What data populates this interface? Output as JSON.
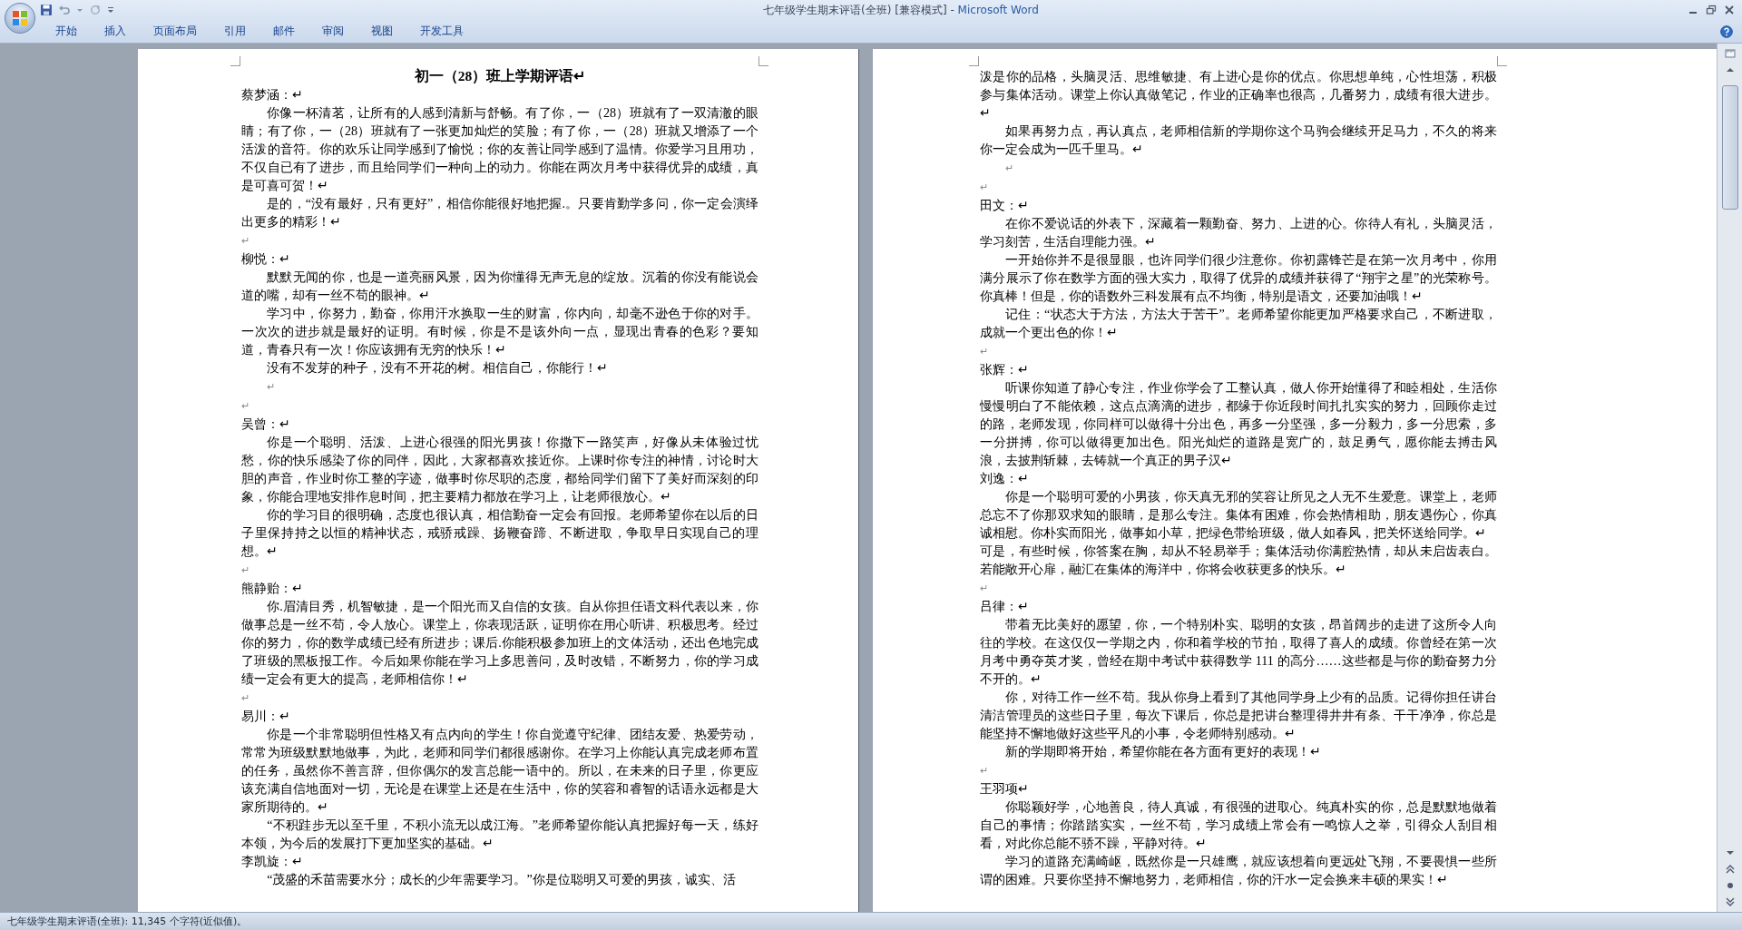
{
  "window": {
    "title": "七年级学生期末评语(全班) [兼容模式] -",
    "app_name": "Microsoft Word"
  },
  "tabs": [
    {
      "label": "开始",
      "selected": false
    },
    {
      "label": "插入",
      "selected": false
    },
    {
      "label": "页面布局",
      "selected": false
    },
    {
      "label": "引用",
      "selected": false
    },
    {
      "label": "邮件",
      "selected": false
    },
    {
      "label": "审阅",
      "selected": false
    },
    {
      "label": "视图",
      "selected": false
    },
    {
      "label": "开发工具",
      "selected": false
    }
  ],
  "pages": [
    {
      "blocks": [
        {
          "kind": "title",
          "text": "初一（28）班上学期评语↵"
        },
        {
          "kind": "name",
          "text": "蔡梦涵：↵"
        },
        {
          "kind": "para",
          "text": "你像一杯清茗，让所有的人感到清新与舒畅。有了你，一（28）班就有了一双清澈的眼睛；有了你，一（28）班就有了一张更加灿烂的笑脸；有了你，一（28）班就又增添了一个活泼的音符。你的欢乐让同学感到了愉悦；你的友善让同学感到了温情。你爱学习且用功，不仅自已有了进步，而且给同学们一种向上的动力。你能在两次月考中获得优异的成绩，真是可喜可贺！↵"
        },
        {
          "kind": "para",
          "text": "是的，“没有最好，只有更好”，相信你能很好地把握.。只要肯勤学多问，你一定会演绎出更多的精彩！↵"
        },
        {
          "kind": "blank",
          "text": "↵"
        },
        {
          "kind": "name",
          "text": "柳悦：↵"
        },
        {
          "kind": "para",
          "text": "默默无闻的你，也是一道亮丽风景，因为你懂得无声无息的绽放。沉着的你没有能说会道的嘴，却有一丝不苟的眼神。↵"
        },
        {
          "kind": "para",
          "text": "学习中，你努力，勤奋，你用汗水换取一生的财富，你内向，却毫不逊色于你的对手。一次次的进步就是最好的证明。有时候，你是不是该外向一点，显现出青春的色彩？要知道，青春只有一次！你应该拥有无穷的快乐！↵"
        },
        {
          "kind": "para",
          "text": "没有不发芽的种子，没有不开花的树。相信自己，你能行！↵"
        },
        {
          "kind": "blank-indented",
          "text": "↵"
        },
        {
          "kind": "blank",
          "text": "↵"
        },
        {
          "kind": "name",
          "text": "吴曾：↵"
        },
        {
          "kind": "para",
          "text": "你是一个聪明、活泼、上进心很强的阳光男孩！你撒下一路笑声，好像从未体验过忧愁，你的快乐感染了你的同伴，因此，大家都喜欢接近你。上课时你专注的神情，讨论时大胆的声音，作业时你工整的字迹，做事时你尽职的态度，都给同学们留下了美好而深刻的印象，你能合理地安排作息时间，把主要精力都放在学习上，让老师很放心。↵"
        },
        {
          "kind": "para",
          "text": "你的学习目的很明确，态度也很认真，相信勤奋一定会有回报。老师希望你在以后的日子里保持持之以恒的精神状态，戒骄戒躁、扬鞭奋蹄、不断进取，争取早日实现自己的理想。↵"
        },
        {
          "kind": "blank",
          "text": "↵"
        },
        {
          "kind": "name",
          "text": "熊静贻：↵"
        },
        {
          "kind": "para",
          "text": "你.眉清目秀，机智敏捷，是一个阳光而又自信的女孩。自从你担任语文科代表以来，你做事总是一丝不苟，令人放心。课堂上，你表现活跃，证明你在用心听讲、积极思考。经过你的努力，你的数学成绩已经有所进步；课后.你能积极参加班上的文体活动，还出色地完成了班级的黑板报工作。今后如果你能在学习上多思善问，及时改错，不断努力，你的学习成绩一定会有更大的提高，老师相信你！↵"
        },
        {
          "kind": "blank",
          "text": "↵"
        },
        {
          "kind": "name",
          "text": "易川：↵"
        },
        {
          "kind": "para",
          "text": "你是一个非常聪明但性格又有点内向的学生！你自觉遵守纪律、团结友爱、热爱劳动，常常为班级默默地做事，为此，老师和同学们都很感谢你。在学习上你能认真完成老师布置的任务，虽然你不善言辞，但你偶尔的发言总能一语中的。所以，在未来的日子里，你更应该充满自信地面对一切，无论是在课堂上还是在生活中，你的笑容和睿智的话语永远都是大家所期待的。↵"
        },
        {
          "kind": "para",
          "text": "“不积跬步无以至千里，不积小流无以成江海。”老师希望你能认真把握好每一天，练好本领，为今后的发展打下更加坚实的基础。↵"
        },
        {
          "kind": "name",
          "text": "李凯旋：↵"
        },
        {
          "kind": "para",
          "text": "“茂盛的禾苗需要水分；成长的少年需要学习。”你是位聪明又可爱的男孩，诚实、活"
        }
      ]
    },
    {
      "blocks": [
        {
          "kind": "plain",
          "text": "泼是你的品格，头脑灵活、思维敏捷、有上进心是你的优点。你思想单纯，心性坦荡，积极参与集体活动。课堂上你认真做笔记，作业的正确率也很高，几番努力，成绩有很大进步。↵"
        },
        {
          "kind": "para",
          "text": "如果再努力点，再认真点，老师相信新的学期你这个马驹会继续开足马力，不久的将来你一定会成为一匹千里马。↵"
        },
        {
          "kind": "blank-indented",
          "text": "↵"
        },
        {
          "kind": "blank",
          "text": "↵"
        },
        {
          "kind": "name",
          "text": "田文：↵"
        },
        {
          "kind": "para",
          "text": "在你不爱说话的外表下，深藏着一颗勤奋、努力、上进的心。你待人有礼，头脑灵活，学习刻苦，生活自理能力强。↵"
        },
        {
          "kind": "para",
          "text": "一开始你并不是很显眼，也许同学们很少注意你。你初露锋芒是在第一次月考中，你用满分展示了你在数学方面的强大实力，取得了优异的成绩并获得了“翔宇之星”的光荣称号。你真棒！但是，你的语数外三科发展有点不均衡，特别是语文，还要加油哦！↵"
        },
        {
          "kind": "para",
          "text": "记住：“状态大于方法，方法大于苦干”。老师希望你能更加严格要求自己，不断进取，成就一个更出色的你！↵"
        },
        {
          "kind": "blank",
          "text": "↵"
        },
        {
          "kind": "name",
          "text": "张辉：↵"
        },
        {
          "kind": "para",
          "text": "听课你知道了静心专注，作业你学会了工整认真，做人你开始懂得了和睦相处，生活你慢慢明白了不能依赖，这点点滴滴的进步，都缘于你近段时间扎扎实实的努力，回顾你走过的路，老师发现，你同样可以做得十分出色，再多一分坚强，多一分毅力，多一分思索，多一分拼搏，你可以做得更加出色。阳光灿烂的道路是宽广的，鼓足勇气，愿你能去搏击风浪，去披荆斩棘，去铸就一个真正的男子汉↵"
        },
        {
          "kind": "name",
          "text": "刘逸：↵"
        },
        {
          "kind": "para",
          "text": "你是一个聪明可爱的小男孩，你天真无邪的笑容让所见之人无不生爱意。课堂上，老师总忘不了你那双求知的眼睛，是那么专注。集体有困难，你会热情相助，朋友遇伤心，你真诚相慰。你朴实而阳光，做事如小草，把绿色带给班级，做人如春风，把关怀送给同学。↵"
        },
        {
          "kind": "plain",
          "text": "可是，有些时候，你答案在胸，却从不轻易举手；集体活动你满腔热情，却从未启齿表白。若能敞开心扉，融汇在集体的海洋中，你将会收获更多的快乐。↵"
        },
        {
          "kind": "blank",
          "text": "↵"
        },
        {
          "kind": "name",
          "text": "吕律：↵"
        },
        {
          "kind": "para",
          "text": "带着无比美好的愿望，你，一个特别朴实、聪明的女孩，昂首阔步的走进了这所令人向往的学校。在这仅仅一学期之内，你和着学校的节拍，取得了喜人的成绩。你曾经在第一次月考中勇夺英才奖，曾经在期中考试中获得数学 111 的高分……这些都是与你的勤奋努力分不开的。↵"
        },
        {
          "kind": "para",
          "text": "你，对待工作一丝不苟。我从你身上看到了其他同学身上少有的品质。记得你担任讲台清洁管理员的这些日子里，每次下课后，你总是把讲台整理得井井有条、干干净净，你总是能坚持不懈地做好这些平凡的小事，令老师特别感动。↵"
        },
        {
          "kind": "para",
          "text": "新的学期即将开始，希望你能在各方面有更好的表现！↵"
        },
        {
          "kind": "blank",
          "text": "↵"
        },
        {
          "kind": "name",
          "text": "王羽项↵"
        },
        {
          "kind": "para",
          "text": "你聪颖好学，心地善良，待人真诚，有很强的进取心。纯真朴实的你，总是默默地做着自己的事情；你踏踏实实，一丝不苟，学习成绩上常会有一鸣惊人之举，引得众人刮目相看，对此你总能不骄不躁，平静对待。↵"
        },
        {
          "kind": "para",
          "text": "学习的道路充满崎岖，既然你是一只雄鹰，就应该想着向更远处飞翔，不要畏惧一些所谓的困难。只要你坚持不懈地努力，老师相信，你的汗水一定会换来丰硕的果实！↵"
        }
      ]
    }
  ],
  "status_bar": {
    "text": "七年级学生期末评语(全班): 11,345 个字符(近似值)。"
  }
}
